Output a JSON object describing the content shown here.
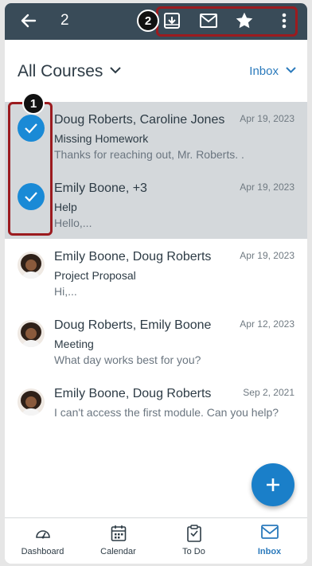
{
  "toolbar": {
    "selected_count": "2",
    "back_icon": "back-arrow-icon",
    "actions": [
      "archive-icon",
      "mark-unread-envelope-icon",
      "star-icon",
      "more-vertical-icon"
    ]
  },
  "callouts": {
    "one": "1",
    "two": "2"
  },
  "filter": {
    "title": "All Courses",
    "scope": "Inbox"
  },
  "messages": [
    {
      "names": "Doug Roberts, Caroline Jones",
      "date": "Apr 19, 2023",
      "subject": "Missing Homework",
      "preview": "Thanks for reaching out, Mr. Roberts. ...",
      "selected": true
    },
    {
      "names": "Emily Boone, +3",
      "date": "Apr 19, 2023",
      "subject": "Help",
      "preview": "Hello,...",
      "selected": true
    },
    {
      "names": "Emily Boone, Doug Roberts",
      "date": "Apr 19, 2023",
      "subject": "Project Proposal",
      "preview": "Hi,...",
      "selected": false
    },
    {
      "names": "Doug Roberts, Emily Boone",
      "date": "Apr 12, 2023",
      "subject": "Meeting",
      "preview": "What day works best for you?",
      "selected": false
    },
    {
      "names": "Emily Boone, Doug Roberts",
      "date": "Sep 2, 2021",
      "subject": "",
      "preview": "I can't access the first module. Can you help?",
      "selected": false
    }
  ],
  "tabs": [
    {
      "label": "Dashboard",
      "icon": "dashboard-gauge-icon"
    },
    {
      "label": "Calendar",
      "icon": "calendar-icon"
    },
    {
      "label": "To Do",
      "icon": "clipboard-todo-icon"
    },
    {
      "label": "Inbox",
      "icon": "inbox-envelope-icon",
      "active": true
    }
  ],
  "colors": {
    "toolbar": "#394b58",
    "accent": "#1a8ad6",
    "callout": "#9b1b1f"
  }
}
